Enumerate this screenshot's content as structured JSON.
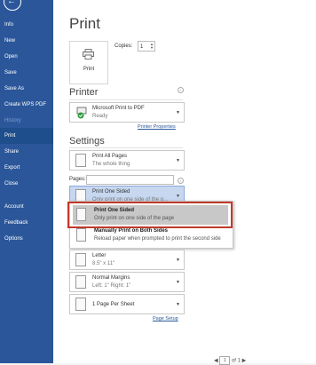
{
  "sidebar": {
    "items": [
      {
        "label": "Info"
      },
      {
        "label": "New"
      },
      {
        "label": "Open"
      },
      {
        "label": "Save"
      },
      {
        "label": "Save As"
      },
      {
        "label": "Create WPS PDF"
      },
      {
        "label": "History"
      },
      {
        "label": "Print"
      },
      {
        "label": "Share"
      },
      {
        "label": "Export"
      },
      {
        "label": "Close"
      },
      {
        "label": "Account"
      },
      {
        "label": "Feedback"
      },
      {
        "label": "Options"
      }
    ]
  },
  "main": {
    "title": "Print",
    "print_button": "Print",
    "copies_label": "Copies:",
    "copies_value": "1",
    "printer": {
      "heading": "Printer",
      "name": "Microsoft Print to PDF",
      "status": "Ready",
      "properties_link": "Printer Properties"
    },
    "settings": {
      "heading": "Settings",
      "print_range": {
        "title": "Print All Pages",
        "subtitle": "The whole thing"
      },
      "pages_label": "Pages:",
      "sides": {
        "title": "Print One Sided",
        "subtitle": "Only print on one side of the p..."
      },
      "menu": [
        {
          "title": "Print One Sided",
          "subtitle": "Only print on one side of the page"
        },
        {
          "title": "Manually Print on Both Sides",
          "subtitle": "Reload paper when prompted to print the second side"
        }
      ],
      "paper": {
        "title": "Letter",
        "subtitle": "8.5\" x 11\""
      },
      "margins": {
        "title": "Normal Margins",
        "subtitle": "Left: 1\"   Right: 1\""
      },
      "per_sheet": {
        "title": "1 Page Per Sheet"
      },
      "page_setup_link": "Page Setup"
    },
    "pager": {
      "prev": "◀",
      "current": "1",
      "of": "of 1",
      "next": "▶"
    }
  },
  "colors": {
    "sidebar": "#2b579a",
    "highlight": "#c0392b"
  }
}
